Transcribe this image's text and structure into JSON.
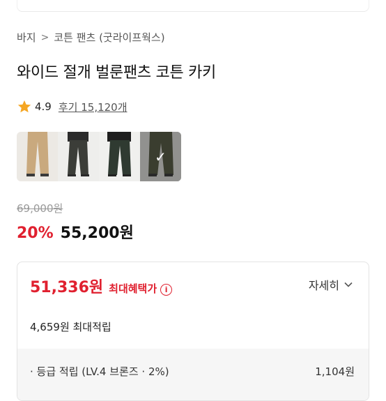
{
  "breadcrumb": {
    "items": [
      "바지",
      "코튼 팬츠 (굿라이프웍스)"
    ],
    "separator": ">"
  },
  "product": {
    "title": "와이드 절개 벌룬팬츠 코튼 카키",
    "rating": "4.9",
    "review_text": "후기 15,120개"
  },
  "thumbnails": [
    {
      "color_name": "beige",
      "color": "#c9a97e"
    },
    {
      "color_name": "charcoal",
      "color": "#3b3d38"
    },
    {
      "color_name": "dark-green",
      "color": "#2f3a31"
    },
    {
      "color_name": "khaki",
      "color": "#4a4f36",
      "selected": true
    }
  ],
  "pricing": {
    "original_price": "69,000원",
    "discount": "20%",
    "sale_price": "55,200원"
  },
  "benefit": {
    "amount": "51,336원",
    "label": "최대혜택가",
    "info_icon": "info-icon",
    "detail_label": "자세히",
    "points": "4,659원 최대적립",
    "grade_label": "· 등급 적립 (LV.4 브론즈 · 2%)",
    "grade_value": "1,104원"
  },
  "colors": {
    "accent_red": "#e0202f",
    "star": "#f5a623"
  }
}
